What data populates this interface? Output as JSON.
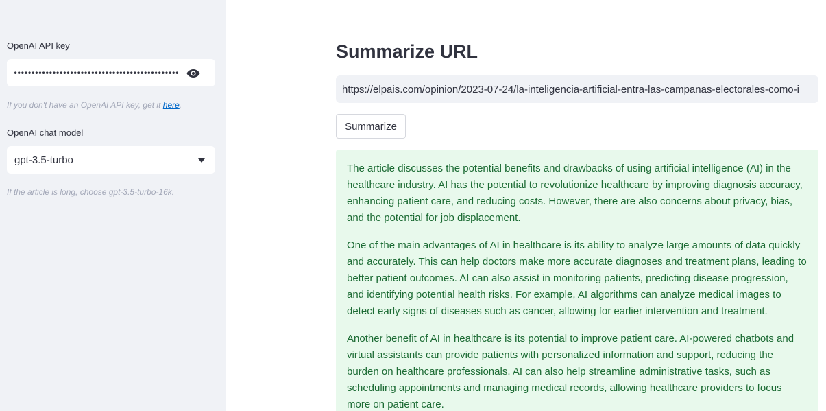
{
  "sidebar": {
    "api_key_label": "OpenAI API key",
    "api_key_value": "••••••••••••••••••••••••••••••••••••••••••••••••••••",
    "api_key_help_prefix": "If you don't have an OpenAI API key, get it ",
    "api_key_help_link": "here",
    "api_key_help_suffix": ".",
    "model_label": "OpenAI chat model",
    "model_value": "gpt-3.5-turbo",
    "model_help": "If the article is long, choose gpt-3.5-turbo-16k."
  },
  "main": {
    "title": "Summarize URL",
    "url_value": "https://elpais.com/opinion/2023-07-24/la-inteligencia-artificial-entra-las-campanas-electorales-como-i",
    "summarize_button": "Summarize",
    "summary": [
      "The article discusses the potential benefits and drawbacks of using artificial intelligence (AI) in the healthcare industry. AI has the potential to revolutionize healthcare by improving diagnosis accuracy, enhancing patient care, and reducing costs. However, there are also concerns about privacy, bias, and the potential for job displacement.",
      "One of the main advantages of AI in healthcare is its ability to analyze large amounts of data quickly and accurately. This can help doctors make more accurate diagnoses and treatment plans, leading to better patient outcomes. AI can also assist in monitoring patients, predicting disease progression, and identifying potential health risks. For example, AI algorithms can analyze medical images to detect early signs of diseases such as cancer, allowing for earlier intervention and treatment.",
      "Another benefit of AI in healthcare is its potential to improve patient care. AI-powered chatbots and virtual assistants can provide patients with personalized information and support, reducing the burden on healthcare professionals. AI can also help streamline administrative tasks, such as scheduling appointments and managing medical records, allowing healthcare providers to focus more on patient care."
    ]
  },
  "icons": {
    "eye": "eye-icon",
    "caret": "chevron-down-icon"
  },
  "colors": {
    "sidebar_bg": "#f0f2f6",
    "success_bg": "#e8f9ec",
    "success_text": "#1c6b34",
    "link": "#0068c9"
  }
}
